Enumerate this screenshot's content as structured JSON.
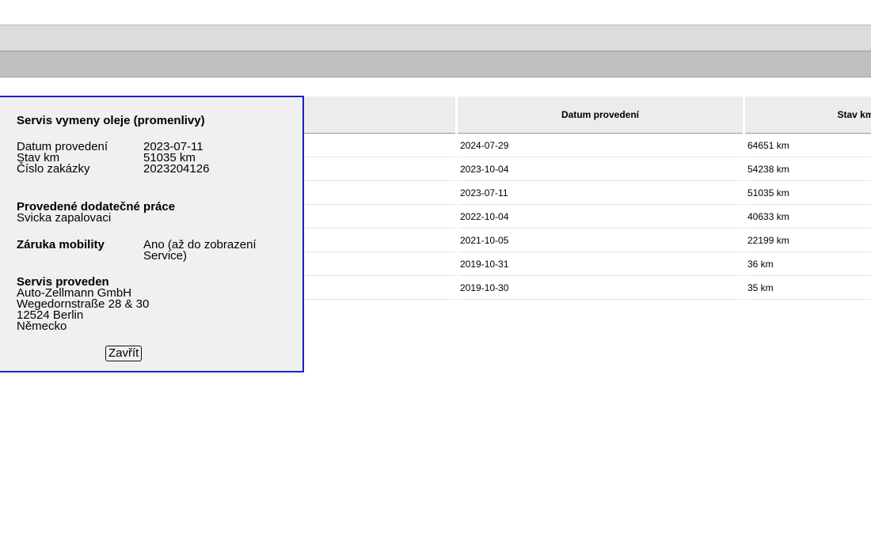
{
  "table": {
    "headers": [
      "",
      "Datum provedení",
      "Stav km"
    ],
    "rows": [
      {
        "date": "2024-07-29",
        "km": "64651 km"
      },
      {
        "date": "2023-10-04",
        "km": "54238 km"
      },
      {
        "date": "2023-07-11",
        "km": "51035 km"
      },
      {
        "date": "2022-10-04",
        "km": "40633 km"
      },
      {
        "date": "2021-10-05",
        "km": "22199 km"
      },
      {
        "date": "2019-10-31",
        "km": "36 km"
      },
      {
        "date": "2019-10-30",
        "km": "35 km"
      }
    ]
  },
  "popup": {
    "title": "Servis vymeny oleje (promenlivy)",
    "details": [
      {
        "label": "Datum provedení",
        "value": "2023-07-11"
      },
      {
        "label": "Stav km",
        "value": "51035 km"
      },
      {
        "label": "Číslo zakázky",
        "value": "2023204126"
      }
    ],
    "extra_work_heading": "Provedené dodatečné práce",
    "extra_work_value": "Svicka zapalovaci",
    "mobility_label": "Záruka mobility",
    "mobility_value": "Ano (až do zobrazení Service)",
    "performed_heading": "Servis proveden",
    "address_lines": [
      "Auto-Zellmann GmbH",
      "Wegedornstraße 28 & 30",
      "12524 Berlin",
      "Německo"
    ],
    "close_label": "Zavřít"
  },
  "colors": {
    "popup_border": "#1f1fc8",
    "header_bg": "#ececec"
  }
}
